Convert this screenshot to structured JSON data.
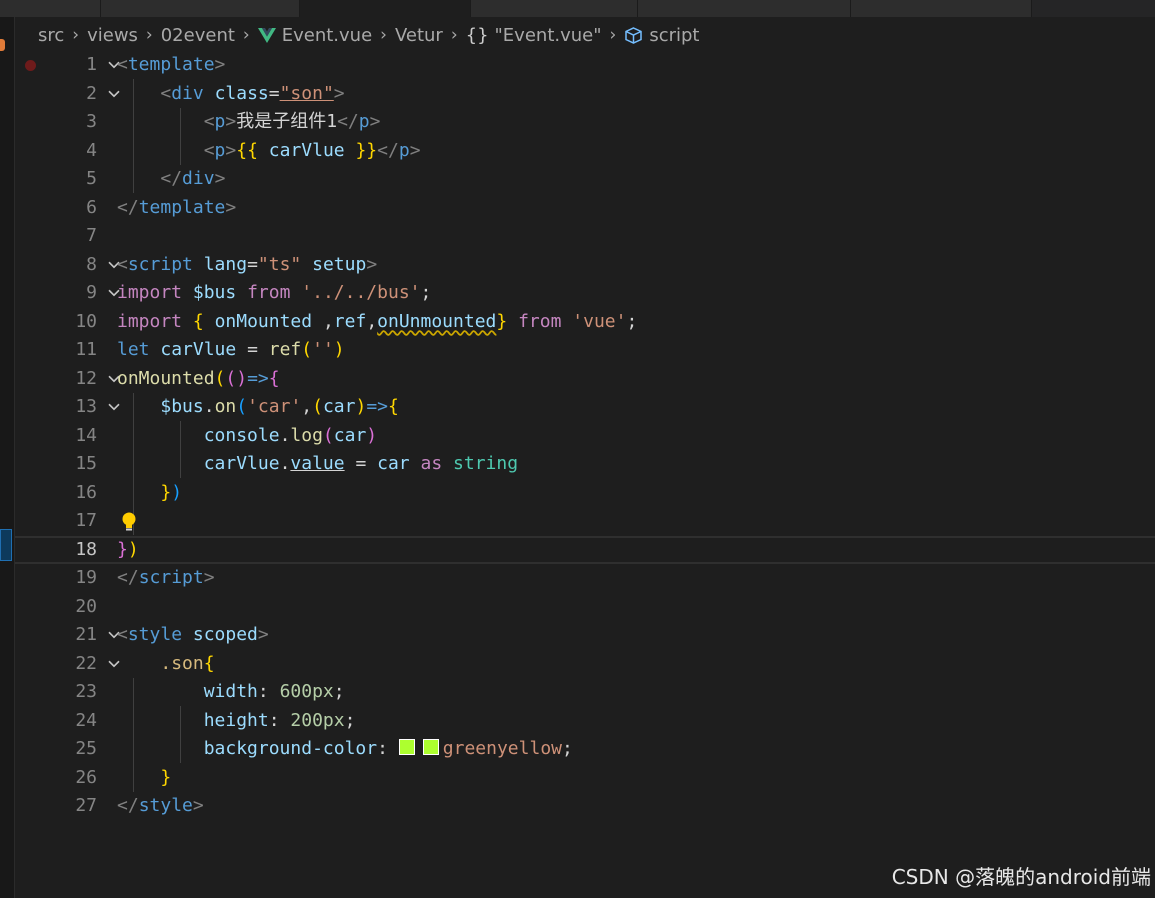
{
  "breadcrumb": {
    "items": [
      "src",
      "views",
      "02event",
      "Event.vue",
      "Vetur",
      "\"Event.vue\"",
      "script"
    ],
    "braces": "{}"
  },
  "editor": {
    "current_line": 18,
    "lines": [
      {
        "n": "1"
      },
      {
        "n": "2"
      },
      {
        "n": "3"
      },
      {
        "n": "4"
      },
      {
        "n": "5"
      },
      {
        "n": "6"
      },
      {
        "n": "7"
      },
      {
        "n": "8"
      },
      {
        "n": "9"
      },
      {
        "n": "10"
      },
      {
        "n": "11"
      },
      {
        "n": "12"
      },
      {
        "n": "13"
      },
      {
        "n": "14"
      },
      {
        "n": "15"
      },
      {
        "n": "16"
      },
      {
        "n": "17"
      },
      {
        "n": "18"
      },
      {
        "n": "19"
      },
      {
        "n": "20"
      },
      {
        "n": "21"
      },
      {
        "n": "22"
      },
      {
        "n": "23"
      },
      {
        "n": "24"
      },
      {
        "n": "25"
      },
      {
        "n": "26"
      },
      {
        "n": "27"
      }
    ],
    "text": {
      "template": "template",
      "div": "div",
      "class": "class",
      "son_str": "\"son\"",
      "p": "p",
      "p_text": "我是子组件1",
      "carVlue": "carVlue",
      "script": "script",
      "lang": "lang",
      "ts_str": "\"ts\"",
      "setup": "setup",
      "import": "import",
      "bus": "$bus",
      "from": "from",
      "bus_path": "'../../bus'",
      "onMounted": "onMounted",
      "ref": "ref",
      "onUnmounted": "onUnmounted",
      "vue_str": "'vue'",
      "let": "let",
      "on": "on",
      "car_str": "'car'",
      "car": "car",
      "console": "console",
      "log": "log",
      "value": "value",
      "as": "as",
      "string": "string",
      "empty_str": "''",
      "style": "style",
      "scoped": "scoped",
      "son_sel": ".son",
      "width": "width",
      "height": "height",
      "bg_prop": "background-color",
      "v600": "600px",
      "v200": "200px",
      "greenyellow": "greenyellow"
    }
  },
  "colors": {
    "swatch": "#adff2f",
    "keyword": "#c586c0",
    "tag": "#569cd6"
  },
  "watermark": "CSDN @落魄的android前端"
}
